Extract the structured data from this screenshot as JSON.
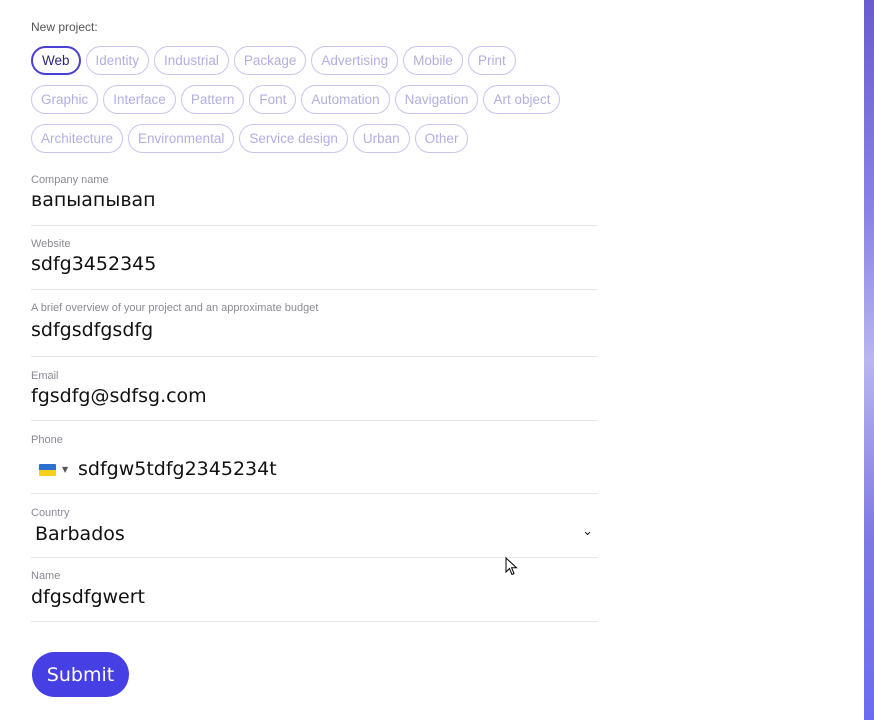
{
  "form": {
    "section_label": "New project:",
    "chip_rows": [
      [
        {
          "label": "Web",
          "active": true
        },
        {
          "label": "Identity"
        },
        {
          "label": "Industrial"
        },
        {
          "label": "Package"
        },
        {
          "label": "Advertising"
        },
        {
          "label": "Mobile"
        },
        {
          "label": "Print"
        }
      ],
      [
        {
          "label": "Graphic"
        },
        {
          "label": "Interface"
        },
        {
          "label": "Pattern"
        },
        {
          "label": "Font"
        },
        {
          "label": "Automation"
        },
        {
          "label": "Navigation"
        },
        {
          "label": "Art object"
        }
      ],
      [
        {
          "label": "Architecture"
        },
        {
          "label": "Environmental"
        },
        {
          "label": "Service design"
        },
        {
          "label": "Urban"
        },
        {
          "label": "Other"
        }
      ]
    ],
    "company": {
      "label": "Company name",
      "value": "вапыапывап"
    },
    "website": {
      "label": "Website",
      "value": "sdfg3452345"
    },
    "overview": {
      "label": "A brief overview of your project and an approximate budget",
      "value": "sdfgsdfgsdfg"
    },
    "email": {
      "label": "Email",
      "value": "fgsdfg@sdfsg.com"
    },
    "phone": {
      "label": "Phone",
      "value": "sdfgw5tdfg2345234t",
      "flag_icon": "ukraine-flag-icon"
    },
    "country": {
      "label": "Country",
      "value": "Barbados"
    },
    "name": {
      "label": "Name",
      "value": "dfgsdfgwert"
    },
    "submit_label": "Submit"
  },
  "colors": {
    "accent": "#463fe3",
    "chip_border": "#c9c5ee",
    "chip_text": "#b3aee0"
  }
}
